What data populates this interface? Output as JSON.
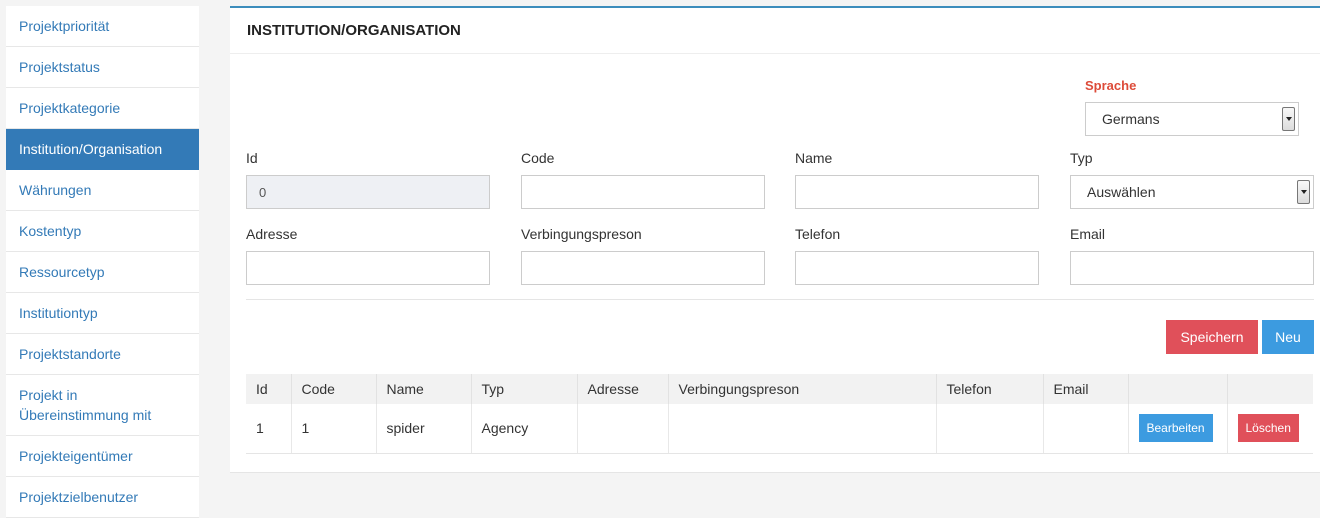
{
  "sidebar": {
    "items": [
      {
        "label": "Projektpriorität"
      },
      {
        "label": "Projektstatus"
      },
      {
        "label": "Projektkategorie"
      },
      {
        "label": "Institution/Organisation"
      },
      {
        "label": "Währungen"
      },
      {
        "label": "Kostentyp"
      },
      {
        "label": "Ressourcetyp"
      },
      {
        "label": "Institutiontyp"
      },
      {
        "label": "Projektstandorte"
      },
      {
        "label": "Projekt in Übereinstimmung mit"
      },
      {
        "label": "Projekteigentümer"
      },
      {
        "label": "Projektzielbenutzer"
      }
    ],
    "active_index": 3
  },
  "panel": {
    "title": "INSTITUTION/ORGANISATION",
    "language": {
      "label": "Sprache",
      "selected": "Germans"
    },
    "form": {
      "id": {
        "label": "Id",
        "value": "0"
      },
      "code": {
        "label": "Code",
        "value": ""
      },
      "name": {
        "label": "Name",
        "value": ""
      },
      "typ": {
        "label": "Typ",
        "selected": "Auswählen"
      },
      "adresse": {
        "label": "Adresse",
        "value": ""
      },
      "verbindungsperson": {
        "label": "Verbingungspreson",
        "value": ""
      },
      "telefon": {
        "label": "Telefon",
        "value": ""
      },
      "email": {
        "label": "Email",
        "value": ""
      }
    },
    "buttons": {
      "save": "Speichern",
      "new": "Neu"
    }
  },
  "table": {
    "columns": [
      "Id",
      "Code",
      "Name",
      "Typ",
      "Adresse",
      "Verbingungspreson",
      "Telefon",
      "Email",
      "",
      ""
    ],
    "rows": [
      {
        "id": "1",
        "code": "1",
        "name": "spider",
        "typ": "Agency",
        "adresse": "",
        "verbindungsperson": "",
        "telefon": "",
        "email": "",
        "edit": "Bearbeiten",
        "delete": "Löschen"
      }
    ]
  },
  "colors": {
    "primary": "#337ab7",
    "danger": "#e0505a",
    "info": "#3c9be0",
    "accent_label": "#dd4b39"
  }
}
